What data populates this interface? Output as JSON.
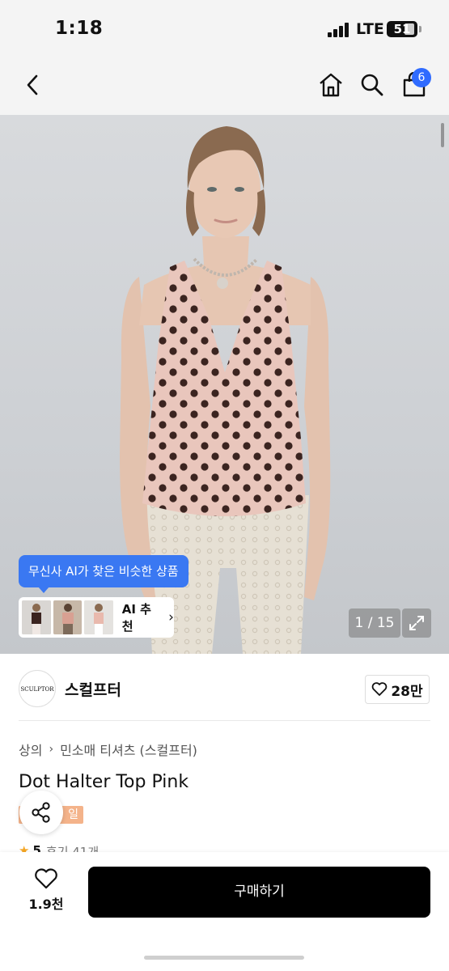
{
  "status_bar": {
    "time": "1:18",
    "network": "LTE",
    "battery": "51"
  },
  "nav": {
    "cart_count": "6"
  },
  "gallery": {
    "ai_tooltip": "무신사 AI가 찾은 비슷한 상품",
    "ai_recommend": "AI 추천",
    "page_indicator": "1 / 15"
  },
  "brand": {
    "logo_text": "SCULPTOR",
    "name": "스컬프터",
    "likes": "28만"
  },
  "product": {
    "breadcrumb": [
      "상의",
      "민소매 티셔츠 (스컬프터)"
    ],
    "title": "Dot Halter Top Pink",
    "deal_badge": "일",
    "rating": "5",
    "reviews": "후기 41개"
  },
  "bottom_bar": {
    "wish_count": "1.9천",
    "buy_label": "구매하기"
  },
  "colors": {
    "accent_blue": "#3a78f2",
    "badge_blue": "#2f6bff",
    "buy_button": "#000000",
    "deal_badge": "#f4b38a"
  }
}
